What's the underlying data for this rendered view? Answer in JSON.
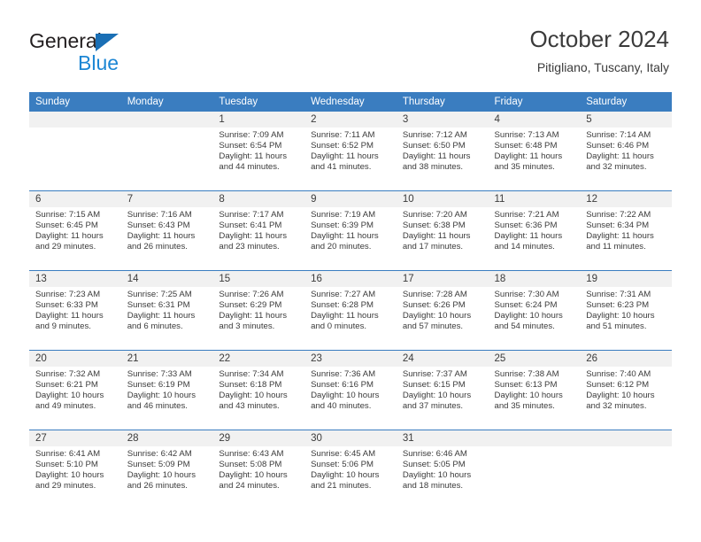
{
  "branding": {
    "name_part1": "General",
    "name_part2": "Blue",
    "triangle_icon": "triangle-logo-icon",
    "color_dark": "#231f20",
    "color_blue": "#1c86d4",
    "color_triangle": "#1a6fb5"
  },
  "header": {
    "title": "October 2024",
    "subtitle": "Pitigliano, Tuscany, Italy"
  },
  "theme": {
    "header_row_bg": "#3a7dc0",
    "header_row_text": "#ffffff",
    "daynum_strip_bg": "#f1f1f1",
    "body_text": "#3b3b3b",
    "row_divider": "#3a7dc0"
  },
  "weekdays": [
    "Sunday",
    "Monday",
    "Tuesday",
    "Wednesday",
    "Thursday",
    "Friday",
    "Saturday"
  ],
  "weeks": [
    [
      {
        "day": "",
        "blank": true,
        "sunrise": "",
        "sunset": "",
        "daylight1": "",
        "daylight2": ""
      },
      {
        "day": "",
        "blank": true,
        "sunrise": "",
        "sunset": "",
        "daylight1": "",
        "daylight2": ""
      },
      {
        "day": "1",
        "blank": false,
        "sunrise": "Sunrise: 7:09 AM",
        "sunset": "Sunset: 6:54 PM",
        "daylight1": "Daylight: 11 hours",
        "daylight2": "and 44 minutes."
      },
      {
        "day": "2",
        "blank": false,
        "sunrise": "Sunrise: 7:11 AM",
        "sunset": "Sunset: 6:52 PM",
        "daylight1": "Daylight: 11 hours",
        "daylight2": "and 41 minutes."
      },
      {
        "day": "3",
        "blank": false,
        "sunrise": "Sunrise: 7:12 AM",
        "sunset": "Sunset: 6:50 PM",
        "daylight1": "Daylight: 11 hours",
        "daylight2": "and 38 minutes."
      },
      {
        "day": "4",
        "blank": false,
        "sunrise": "Sunrise: 7:13 AM",
        "sunset": "Sunset: 6:48 PM",
        "daylight1": "Daylight: 11 hours",
        "daylight2": "and 35 minutes."
      },
      {
        "day": "5",
        "blank": false,
        "sunrise": "Sunrise: 7:14 AM",
        "sunset": "Sunset: 6:46 PM",
        "daylight1": "Daylight: 11 hours",
        "daylight2": "and 32 minutes."
      }
    ],
    [
      {
        "day": "6",
        "blank": false,
        "sunrise": "Sunrise: 7:15 AM",
        "sunset": "Sunset: 6:45 PM",
        "daylight1": "Daylight: 11 hours",
        "daylight2": "and 29 minutes."
      },
      {
        "day": "7",
        "blank": false,
        "sunrise": "Sunrise: 7:16 AM",
        "sunset": "Sunset: 6:43 PM",
        "daylight1": "Daylight: 11 hours",
        "daylight2": "and 26 minutes."
      },
      {
        "day": "8",
        "blank": false,
        "sunrise": "Sunrise: 7:17 AM",
        "sunset": "Sunset: 6:41 PM",
        "daylight1": "Daylight: 11 hours",
        "daylight2": "and 23 minutes."
      },
      {
        "day": "9",
        "blank": false,
        "sunrise": "Sunrise: 7:19 AM",
        "sunset": "Sunset: 6:39 PM",
        "daylight1": "Daylight: 11 hours",
        "daylight2": "and 20 minutes."
      },
      {
        "day": "10",
        "blank": false,
        "sunrise": "Sunrise: 7:20 AM",
        "sunset": "Sunset: 6:38 PM",
        "daylight1": "Daylight: 11 hours",
        "daylight2": "and 17 minutes."
      },
      {
        "day": "11",
        "blank": false,
        "sunrise": "Sunrise: 7:21 AM",
        "sunset": "Sunset: 6:36 PM",
        "daylight1": "Daylight: 11 hours",
        "daylight2": "and 14 minutes."
      },
      {
        "day": "12",
        "blank": false,
        "sunrise": "Sunrise: 7:22 AM",
        "sunset": "Sunset: 6:34 PM",
        "daylight1": "Daylight: 11 hours",
        "daylight2": "and 11 minutes."
      }
    ],
    [
      {
        "day": "13",
        "blank": false,
        "sunrise": "Sunrise: 7:23 AM",
        "sunset": "Sunset: 6:33 PM",
        "daylight1": "Daylight: 11 hours",
        "daylight2": "and 9 minutes."
      },
      {
        "day": "14",
        "blank": false,
        "sunrise": "Sunrise: 7:25 AM",
        "sunset": "Sunset: 6:31 PM",
        "daylight1": "Daylight: 11 hours",
        "daylight2": "and 6 minutes."
      },
      {
        "day": "15",
        "blank": false,
        "sunrise": "Sunrise: 7:26 AM",
        "sunset": "Sunset: 6:29 PM",
        "daylight1": "Daylight: 11 hours",
        "daylight2": "and 3 minutes."
      },
      {
        "day": "16",
        "blank": false,
        "sunrise": "Sunrise: 7:27 AM",
        "sunset": "Sunset: 6:28 PM",
        "daylight1": "Daylight: 11 hours",
        "daylight2": "and 0 minutes."
      },
      {
        "day": "17",
        "blank": false,
        "sunrise": "Sunrise: 7:28 AM",
        "sunset": "Sunset: 6:26 PM",
        "daylight1": "Daylight: 10 hours",
        "daylight2": "and 57 minutes."
      },
      {
        "day": "18",
        "blank": false,
        "sunrise": "Sunrise: 7:30 AM",
        "sunset": "Sunset: 6:24 PM",
        "daylight1": "Daylight: 10 hours",
        "daylight2": "and 54 minutes."
      },
      {
        "day": "19",
        "blank": false,
        "sunrise": "Sunrise: 7:31 AM",
        "sunset": "Sunset: 6:23 PM",
        "daylight1": "Daylight: 10 hours",
        "daylight2": "and 51 minutes."
      }
    ],
    [
      {
        "day": "20",
        "blank": false,
        "sunrise": "Sunrise: 7:32 AM",
        "sunset": "Sunset: 6:21 PM",
        "daylight1": "Daylight: 10 hours",
        "daylight2": "and 49 minutes."
      },
      {
        "day": "21",
        "blank": false,
        "sunrise": "Sunrise: 7:33 AM",
        "sunset": "Sunset: 6:19 PM",
        "daylight1": "Daylight: 10 hours",
        "daylight2": "and 46 minutes."
      },
      {
        "day": "22",
        "blank": false,
        "sunrise": "Sunrise: 7:34 AM",
        "sunset": "Sunset: 6:18 PM",
        "daylight1": "Daylight: 10 hours",
        "daylight2": "and 43 minutes."
      },
      {
        "day": "23",
        "blank": false,
        "sunrise": "Sunrise: 7:36 AM",
        "sunset": "Sunset: 6:16 PM",
        "daylight1": "Daylight: 10 hours",
        "daylight2": "and 40 minutes."
      },
      {
        "day": "24",
        "blank": false,
        "sunrise": "Sunrise: 7:37 AM",
        "sunset": "Sunset: 6:15 PM",
        "daylight1": "Daylight: 10 hours",
        "daylight2": "and 37 minutes."
      },
      {
        "day": "25",
        "blank": false,
        "sunrise": "Sunrise: 7:38 AM",
        "sunset": "Sunset: 6:13 PM",
        "daylight1": "Daylight: 10 hours",
        "daylight2": "and 35 minutes."
      },
      {
        "day": "26",
        "blank": false,
        "sunrise": "Sunrise: 7:40 AM",
        "sunset": "Sunset: 6:12 PM",
        "daylight1": "Daylight: 10 hours",
        "daylight2": "and 32 minutes."
      }
    ],
    [
      {
        "day": "27",
        "blank": false,
        "sunrise": "Sunrise: 6:41 AM",
        "sunset": "Sunset: 5:10 PM",
        "daylight1": "Daylight: 10 hours",
        "daylight2": "and 29 minutes."
      },
      {
        "day": "28",
        "blank": false,
        "sunrise": "Sunrise: 6:42 AM",
        "sunset": "Sunset: 5:09 PM",
        "daylight1": "Daylight: 10 hours",
        "daylight2": "and 26 minutes."
      },
      {
        "day": "29",
        "blank": false,
        "sunrise": "Sunrise: 6:43 AM",
        "sunset": "Sunset: 5:08 PM",
        "daylight1": "Daylight: 10 hours",
        "daylight2": "and 24 minutes."
      },
      {
        "day": "30",
        "blank": false,
        "sunrise": "Sunrise: 6:45 AM",
        "sunset": "Sunset: 5:06 PM",
        "daylight1": "Daylight: 10 hours",
        "daylight2": "and 21 minutes."
      },
      {
        "day": "31",
        "blank": false,
        "sunrise": "Sunrise: 6:46 AM",
        "sunset": "Sunset: 5:05 PM",
        "daylight1": "Daylight: 10 hours",
        "daylight2": "and 18 minutes."
      },
      {
        "day": "",
        "blank": true,
        "sunrise": "",
        "sunset": "",
        "daylight1": "",
        "daylight2": ""
      },
      {
        "day": "",
        "blank": true,
        "sunrise": "",
        "sunset": "",
        "daylight1": "",
        "daylight2": ""
      }
    ]
  ]
}
